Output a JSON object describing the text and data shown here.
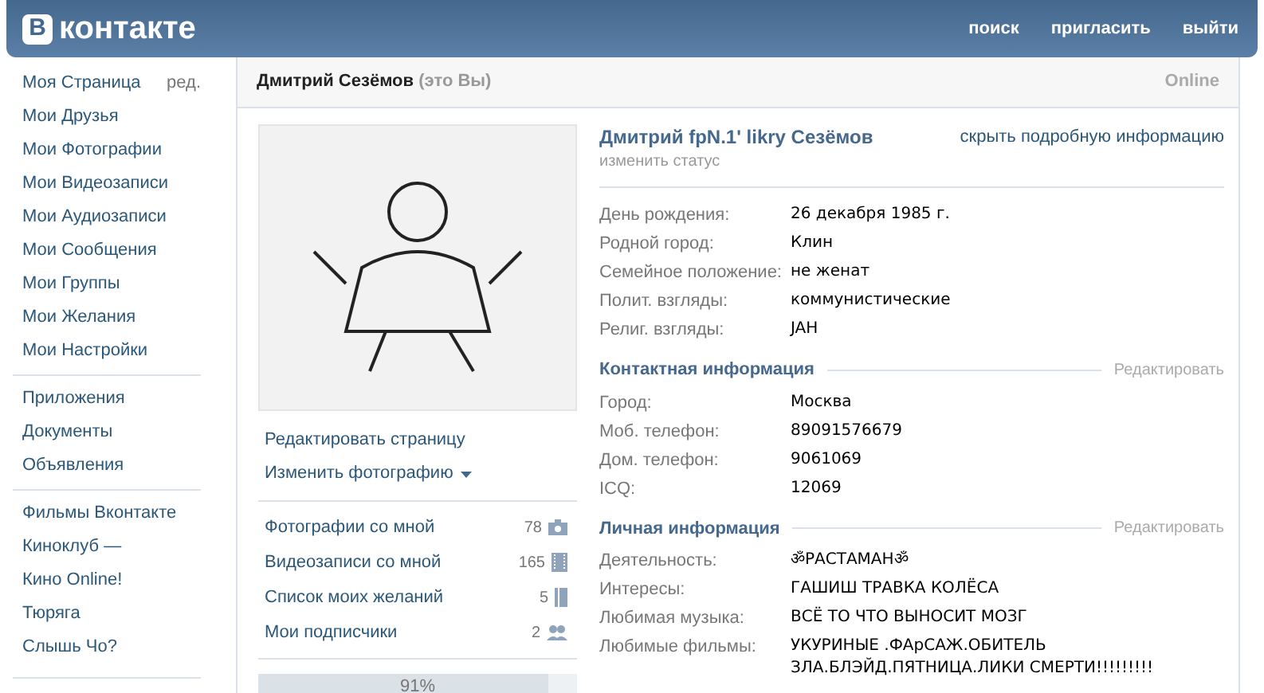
{
  "header": {
    "logo_letter": "В",
    "logo_text": "контакте",
    "links": [
      "поиск",
      "пригласить",
      "выйти"
    ]
  },
  "sidebar": {
    "edit_link": "ред.",
    "groups": [
      [
        "Моя Страница",
        "Мои Друзья",
        "Мои Фотографии",
        "Мои Видеозаписи",
        "Мои Аудиозаписи",
        "Мои Сообщения",
        "Мои Группы",
        "Мои Желания",
        "Мои Настройки"
      ],
      [
        "Приложения",
        "Документы",
        "Объявления"
      ],
      [
        "Фильмы Вконтакте",
        "Киноклуб —",
        "Кино Online!",
        "Тюряга",
        "Слышь Чо?"
      ]
    ]
  },
  "page_header": {
    "name": "Дмитрий Сезёмов",
    "note": "(это Вы)",
    "online": "Online"
  },
  "profile": {
    "actions": [
      "Редактировать страницу",
      "Изменить фотографию"
    ],
    "counters": [
      {
        "label": "Фотографии со мной",
        "count": "78",
        "kind": "photo"
      },
      {
        "label": "Видеозаписи со мной",
        "count": "165",
        "kind": "video"
      },
      {
        "label": "Список моих желаний",
        "count": "5",
        "kind": "wish"
      },
      {
        "label": "Мои подписчики",
        "count": "2",
        "kind": "people"
      }
    ],
    "completion": {
      "level": 0.91,
      "reading": "91%"
    }
  },
  "info": {
    "full_name": "Дмитрий fpN.1' likry Сезёмов",
    "status_link": "изменить статус",
    "hide_link": "скрыть подробную информацию",
    "basic": [
      [
        "День рождения:",
        "26 декабря 1985 г."
      ],
      [
        "Родной город:",
        "Клин"
      ],
      [
        "Семейное положение:",
        "не женат"
      ],
      [
        "Полит. взгляды:",
        "коммунистические"
      ],
      [
        "Религ. взгляды:",
        "JAH"
      ]
    ],
    "sections": [
      {
        "title": "Контактная информация",
        "edit": "Редактировать",
        "rows": [
          [
            "Город:",
            "Москва"
          ],
          [
            "Моб. телефон:",
            "89091576679"
          ],
          [
            "Дом. телефон:",
            "9061069"
          ],
          [
            "ICQ:",
            "12069"
          ]
        ]
      },
      {
        "title": "Личная информация",
        "edit": "Редактировать",
        "rows": [
          [
            "Деятельность:",
            "ॐРАСТАМАНॐ"
          ],
          [
            "Интересы:",
            "ГАШИШ ТРАВКА КОЛЁСА"
          ],
          [
            "Любимая музыка:",
            "ВСЁ ТО ЧТО ВЫНОСИТ МОЗГ"
          ],
          [
            "Любимые фильмы:",
            "УКУРИНЫЕ .ФАрСАЖ.ОБИТЕЛЬ ЗЛА.БЛЭЙД.ПЯТНИЦА.ЛИКИ СМЕРТИ!!!!!!!!!"
          ]
        ]
      }
    ]
  }
}
